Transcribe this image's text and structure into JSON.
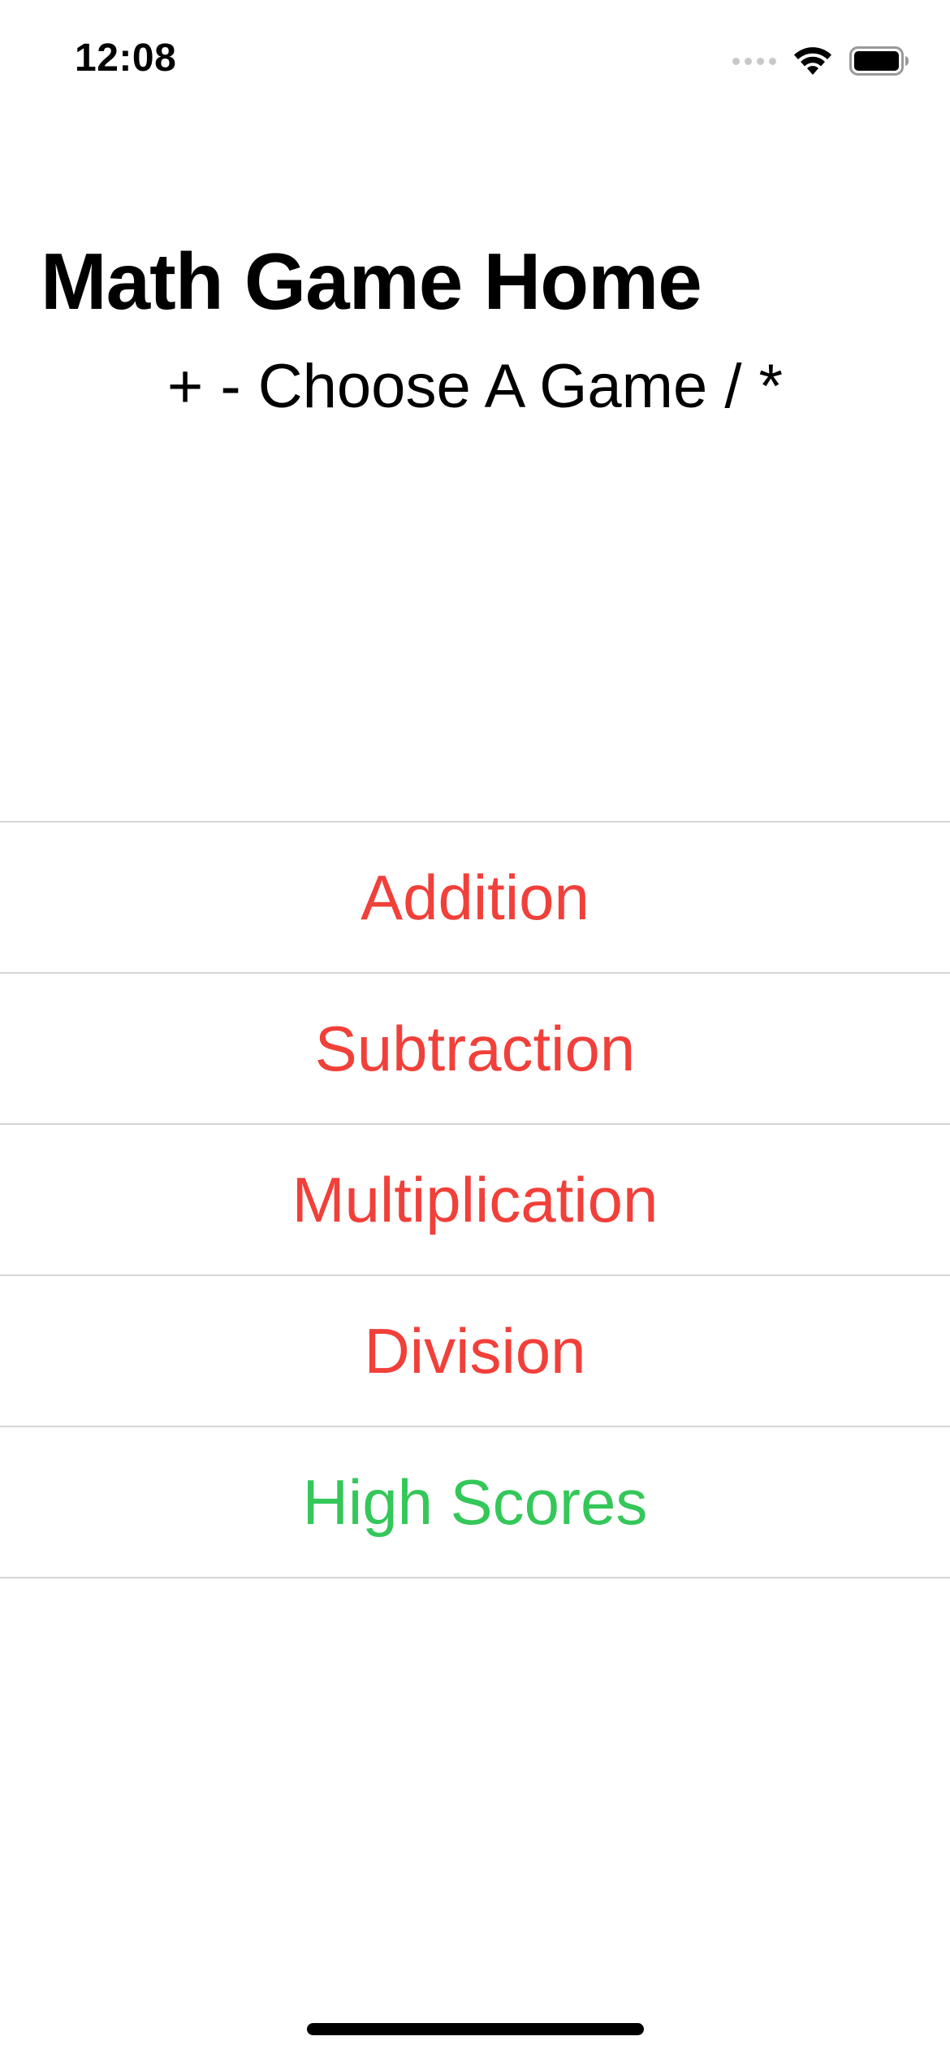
{
  "status_bar": {
    "time": "12:08",
    "wifi_icon": "wifi-icon",
    "battery_icon": "battery-icon"
  },
  "header": {
    "title": "Math Game Home",
    "subtitle": "+ - Choose A Game / *"
  },
  "colors": {
    "game_accent": "#f1403a",
    "high_scores_accent": "#34c759",
    "divider": "#d6d6d6"
  },
  "menu": {
    "items": [
      {
        "label": "Addition",
        "color": "#f1403a"
      },
      {
        "label": "Subtraction",
        "color": "#f1403a"
      },
      {
        "label": "Multiplication",
        "color": "#f1403a"
      },
      {
        "label": "Division",
        "color": "#f1403a"
      },
      {
        "label": "High Scores",
        "color": "#34c759"
      }
    ]
  }
}
